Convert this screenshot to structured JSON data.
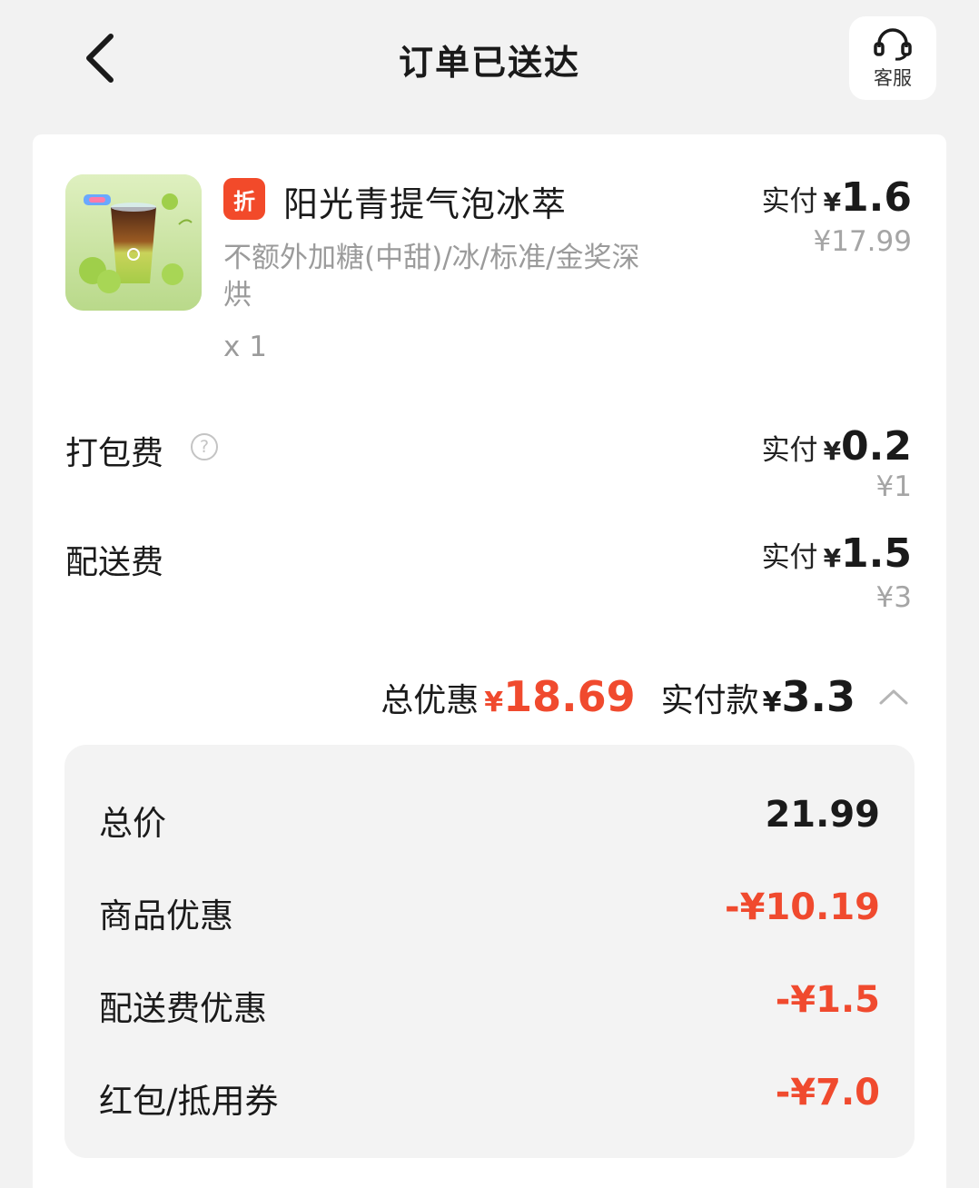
{
  "header": {
    "title": "订单已送达",
    "service_label": "客服",
    "back_icon": "chevron-left-icon",
    "service_icon": "headset-icon"
  },
  "product": {
    "tag": "折",
    "name": "阳光青提气泡冰萃",
    "spec": "不额外加糖(中甜)/冰/标准/金奖深烘",
    "qty": "x 1",
    "pay_prefix": "实付",
    "yen": "¥",
    "pay_amount": "1.6",
    "original_price": "¥17.99"
  },
  "fees": [
    {
      "label": "打包费",
      "pay_prefix": "实付",
      "yen": "¥",
      "pay_amount": "0.2",
      "original_price": "¥1"
    },
    {
      "label": "配送费",
      "pay_prefix": "实付",
      "yen": "¥",
      "pay_amount": "1.5",
      "original_price": "¥3"
    }
  ],
  "summary": {
    "discount_label": "总优惠",
    "yen": "¥",
    "discount_amount": "18.69",
    "paid_label": "实付款",
    "paid_amount": "3.3"
  },
  "breakdown": [
    {
      "label": "总价",
      "value": "21.99",
      "highlight": false
    },
    {
      "label": "商品优惠",
      "value": "-¥10.19",
      "highlight": true
    },
    {
      "label": "配送费优惠",
      "value": "-¥1.5",
      "highlight": true
    },
    {
      "label": "红包/抵用券",
      "value": "-¥7.0",
      "highlight": true
    }
  ],
  "colors": {
    "accent_red": "#f04a2e",
    "tag_red": "#f24a2a",
    "background": "#f2f2f2"
  }
}
